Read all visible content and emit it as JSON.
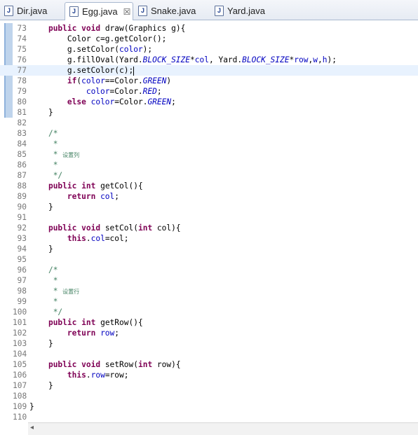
{
  "tabs": [
    {
      "label": "Dir.java",
      "icon": "java-file-icon",
      "active": false
    },
    {
      "label": "Egg.java",
      "icon": "java-file-icon",
      "active": true,
      "close": "☒"
    },
    {
      "label": "Snake.java",
      "icon": "java-file-icon",
      "active": false
    },
    {
      "label": "Yard.java",
      "icon": "java-file-icon",
      "active": false
    }
  ],
  "java_icon_glyph": "J",
  "editor": {
    "current_line": 77,
    "changed_lines": [
      73,
      81
    ],
    "lines": [
      {
        "n": "73",
        "parts": [
          [
            "",
            "    "
          ],
          [
            "kw",
            "public"
          ],
          [
            "",
            " "
          ],
          [
            "kw",
            "void"
          ],
          [
            "",
            " draw(Graphics g){"
          ]
        ]
      },
      {
        "n": "74",
        "parts": [
          [
            "",
            "        Color c=g.getColor();"
          ]
        ]
      },
      {
        "n": "75",
        "parts": [
          [
            "",
            "        g.setColor("
          ],
          [
            "fld",
            "color"
          ],
          [
            "",
            ");"
          ]
        ]
      },
      {
        "n": "76",
        "parts": [
          [
            "",
            "        g.fillOval(Yard."
          ],
          [
            "sfld",
            "BLOCK_SIZE"
          ],
          [
            "",
            "*"
          ],
          [
            "fld",
            "col"
          ],
          [
            "",
            ", Yard."
          ],
          [
            "sfld",
            "BLOCK_SIZE"
          ],
          [
            "",
            "*"
          ],
          [
            "fld",
            "row"
          ],
          [
            "",
            ","
          ],
          [
            "fld",
            "w"
          ],
          [
            "",
            ","
          ],
          [
            "fld",
            "h"
          ],
          [
            "",
            ");"
          ]
        ]
      },
      {
        "n": "77",
        "parts": [
          [
            "",
            "        g.setColor(c);"
          ],
          [
            "caret",
            ""
          ]
        ]
      },
      {
        "n": "78",
        "parts": [
          [
            "",
            "        "
          ],
          [
            "kw",
            "if"
          ],
          [
            "",
            "("
          ],
          [
            "fld",
            "color"
          ],
          [
            "",
            "==Color."
          ],
          [
            "sfld",
            "GREEN"
          ],
          [
            "",
            ")"
          ]
        ]
      },
      {
        "n": "79",
        "parts": [
          [
            "",
            "            "
          ],
          [
            "fld",
            "color"
          ],
          [
            "",
            "=Color."
          ],
          [
            "sfld",
            "RED"
          ],
          [
            "",
            ";"
          ]
        ]
      },
      {
        "n": "80",
        "parts": [
          [
            "",
            "        "
          ],
          [
            "kw",
            "else"
          ],
          [
            "",
            " "
          ],
          [
            "fld",
            "color"
          ],
          [
            "",
            "=Color."
          ],
          [
            "sfld",
            "GREEN"
          ],
          [
            "",
            ";"
          ]
        ]
      },
      {
        "n": "81",
        "parts": [
          [
            "",
            "    }"
          ]
        ]
      },
      {
        "n": "82",
        "parts": [
          [
            "",
            ""
          ]
        ]
      },
      {
        "n": "83",
        "parts": [
          [
            "",
            "    "
          ],
          [
            "cm",
            "/*"
          ]
        ]
      },
      {
        "n": "84",
        "parts": [
          [
            "",
            "     "
          ],
          [
            "cm",
            "*"
          ]
        ]
      },
      {
        "n": "85",
        "parts": [
          [
            "",
            "     "
          ],
          [
            "cm",
            "* "
          ],
          [
            "cmsmall",
            "设置列"
          ]
        ]
      },
      {
        "n": "86",
        "parts": [
          [
            "",
            "     "
          ],
          [
            "cm",
            "*"
          ]
        ]
      },
      {
        "n": "87",
        "parts": [
          [
            "",
            "     "
          ],
          [
            "cm",
            "*/"
          ]
        ]
      },
      {
        "n": "88",
        "parts": [
          [
            "",
            "    "
          ],
          [
            "kw",
            "public"
          ],
          [
            "",
            " "
          ],
          [
            "kw",
            "int"
          ],
          [
            "",
            " getCol(){"
          ]
        ]
      },
      {
        "n": "89",
        "parts": [
          [
            "",
            "        "
          ],
          [
            "kw",
            "return"
          ],
          [
            "",
            " "
          ],
          [
            "fld",
            "col"
          ],
          [
            "",
            ";"
          ]
        ]
      },
      {
        "n": "90",
        "parts": [
          [
            "",
            "    }"
          ]
        ]
      },
      {
        "n": "91",
        "parts": [
          [
            "",
            ""
          ]
        ]
      },
      {
        "n": "92",
        "parts": [
          [
            "",
            "    "
          ],
          [
            "kw",
            "public"
          ],
          [
            "",
            " "
          ],
          [
            "kw",
            "void"
          ],
          [
            "",
            " setCol("
          ],
          [
            "kw",
            "int"
          ],
          [
            "",
            " col){"
          ]
        ]
      },
      {
        "n": "93",
        "parts": [
          [
            "",
            "        "
          ],
          [
            "kw",
            "this"
          ],
          [
            "",
            "."
          ],
          [
            "fld",
            "col"
          ],
          [
            "",
            "=col;"
          ]
        ]
      },
      {
        "n": "94",
        "parts": [
          [
            "",
            "    }"
          ]
        ]
      },
      {
        "n": "95",
        "parts": [
          [
            "",
            ""
          ]
        ]
      },
      {
        "n": "96",
        "parts": [
          [
            "",
            "    "
          ],
          [
            "cm",
            "/*"
          ]
        ]
      },
      {
        "n": "97",
        "parts": [
          [
            "",
            "     "
          ],
          [
            "cm",
            "*"
          ]
        ]
      },
      {
        "n": "98",
        "parts": [
          [
            "",
            "     "
          ],
          [
            "cm",
            "* "
          ],
          [
            "cmsmall",
            "设置行"
          ]
        ]
      },
      {
        "n": "99",
        "parts": [
          [
            "",
            "     "
          ],
          [
            "cm",
            "*"
          ]
        ]
      },
      {
        "n": "100",
        "parts": [
          [
            "",
            "     "
          ],
          [
            "cm",
            "*/"
          ]
        ]
      },
      {
        "n": "101",
        "parts": [
          [
            "",
            "    "
          ],
          [
            "kw",
            "public"
          ],
          [
            "",
            " "
          ],
          [
            "kw",
            "int"
          ],
          [
            "",
            " getRow(){"
          ]
        ]
      },
      {
        "n": "102",
        "parts": [
          [
            "",
            "        "
          ],
          [
            "kw",
            "return"
          ],
          [
            "",
            " "
          ],
          [
            "fld",
            "row"
          ],
          [
            "",
            ";"
          ]
        ]
      },
      {
        "n": "103",
        "parts": [
          [
            "",
            "    }"
          ]
        ]
      },
      {
        "n": "104",
        "parts": [
          [
            "",
            ""
          ]
        ]
      },
      {
        "n": "105",
        "parts": [
          [
            "",
            "    "
          ],
          [
            "kw",
            "public"
          ],
          [
            "",
            " "
          ],
          [
            "kw",
            "void"
          ],
          [
            "",
            " setRow("
          ],
          [
            "kw",
            "int"
          ],
          [
            "",
            " row){"
          ]
        ]
      },
      {
        "n": "106",
        "parts": [
          [
            "",
            "        "
          ],
          [
            "kw",
            "this"
          ],
          [
            "",
            "."
          ],
          [
            "fld",
            "row"
          ],
          [
            "",
            "=row;"
          ]
        ]
      },
      {
        "n": "107",
        "parts": [
          [
            "",
            "    }"
          ]
        ]
      },
      {
        "n": "108",
        "parts": [
          [
            "",
            ""
          ]
        ]
      },
      {
        "n": "109",
        "parts": [
          [
            "",
            "}"
          ]
        ]
      },
      {
        "n": "110",
        "parts": [
          [
            "",
            ""
          ]
        ]
      }
    ]
  },
  "scrollbar": {
    "left_arrow": "◂"
  }
}
